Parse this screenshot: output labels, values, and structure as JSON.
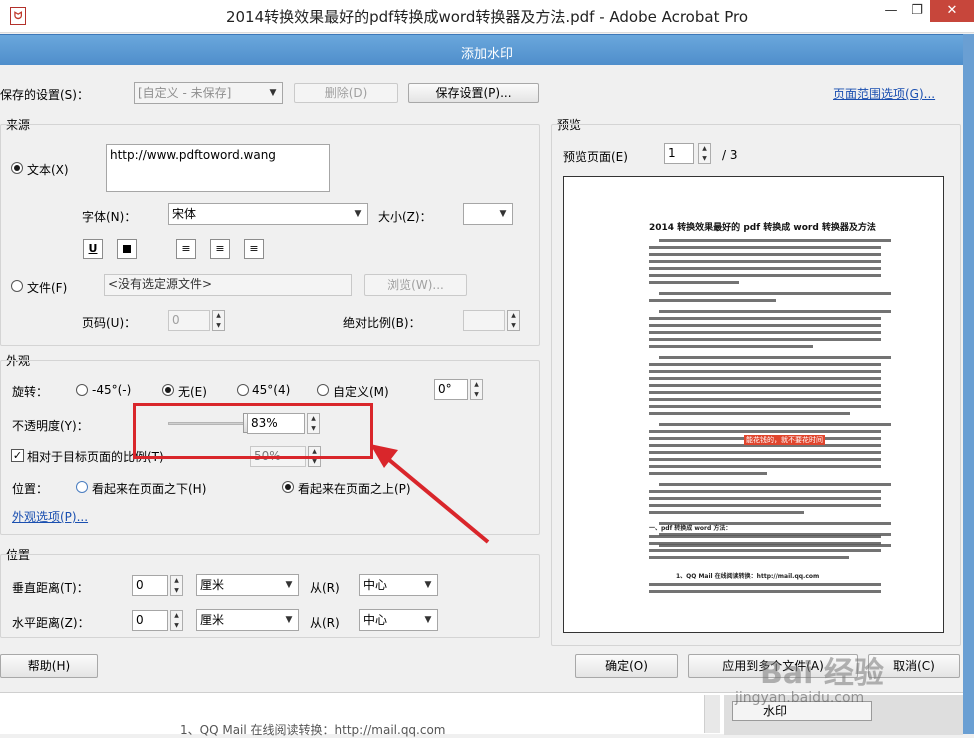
{
  "app": {
    "title": "2014转换效果最好的pdf转换成word转换器及方法.pdf - Adobe Acrobat Pro",
    "minimize": "—",
    "restore": "❐",
    "close": "✕"
  },
  "dialog": {
    "title": "添加水印",
    "saved_settings_label": "保存的设置(S)：",
    "saved_settings_value": "[自定义 - 未保存]",
    "delete_label": "删除(D)",
    "save_settings_label": "保存设置(P)...",
    "page_range_label": "页面范围选项(G)..."
  },
  "source": {
    "section_label": "来源",
    "text_radio_label": "文本(X)",
    "text_value": "http://www.pdftoword.wang",
    "font_label": "字体(N)：",
    "font_value": "宋体",
    "size_label": "大小(Z)：",
    "size_value": "",
    "underline": "U",
    "file_radio_label": "文件(F)",
    "file_value": "<没有选定源文件>",
    "browse_label": "浏览(W)...",
    "page_no_label": "页码(U)：",
    "page_no_value": "0",
    "abs_scale_label": "绝对比例(B)：",
    "abs_scale_value": ""
  },
  "appearance": {
    "section_label": "外观",
    "rotation_label": "旋转：",
    "rot_options": [
      "-45°(-)",
      "无(E)",
      "45°(4)",
      "自定义(M)"
    ],
    "rot_selected": "无(E)",
    "rotation_value": "0°",
    "opacity_label": "不透明度(Y)：",
    "opacity_value": "83%",
    "opacity_level": 0.83,
    "relative_scale_label": "相对于目标页面的比例(T)",
    "relative_scale_value": "50%",
    "position_label": "位置：",
    "pos_behind_label": "看起来在页面之下(H)",
    "pos_front_label": "看起来在页面之上(P)",
    "pos_selected": "看起来在页面之上(P)",
    "options_link": "外观选项(P)..."
  },
  "position": {
    "section_label": "位置",
    "vertical_label": "垂直距离(T)：",
    "vertical_value": "0",
    "vertical_unit": "厘米",
    "vertical_from_label": "从(R)",
    "vertical_from": "中心",
    "horizontal_label": "水平距离(Z)：",
    "horizontal_value": "0",
    "horizontal_unit": "厘米",
    "horizontal_from_label": "从(R)",
    "horizontal_from": "中心"
  },
  "preview": {
    "section_label": "预览",
    "page_label": "预览页面(E)",
    "page_value": "1",
    "page_total": "/ 3",
    "doc_heading": "2014 转换效果最好的 pdf 转换成 word 转换器及方法",
    "doc_watermark": "能花钱的，就不要花时间",
    "doc_section": "一、pdf 转换成 word 方法：",
    "doc_mail": "1、QQ Mail 在线阅读转换：http://mail.qq.com"
  },
  "footer": {
    "help_label": "帮助(H)",
    "ok_label": "确定(O)",
    "apply_label": "应用到多个文件(A)",
    "cancel_label": "取消(C)"
  },
  "background": {
    "doc_text": "1、QQ Mail 在线阅读转换：http://mail.qq.com",
    "side_item": "水印"
  },
  "overlay": {
    "watermark": "Bai 经验",
    "watermark_url": "jingyan.baidu.com"
  },
  "colors": {
    "dialog_title": "#5b9bd5",
    "annotation": "#d9262b",
    "link": "#1a4fb0"
  },
  "icons": [
    "acrobat-icon",
    "minimize-icon",
    "restore-icon",
    "close-icon",
    "arrow-annotation"
  ]
}
